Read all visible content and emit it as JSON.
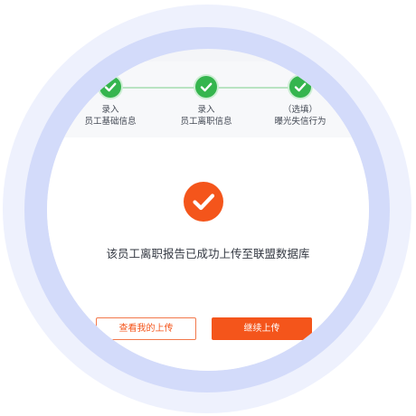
{
  "colors": {
    "accent": "#f4551b",
    "step_done": "#35b54e",
    "ring_outer": "#eef1fd",
    "ring_mid": "#d3dbfa"
  },
  "steps": [
    {
      "line1": "录入",
      "line2": "员工基础信息",
      "status": "done",
      "icon": "check-icon"
    },
    {
      "line1": "录入",
      "line2": "员工离职信息",
      "status": "done",
      "icon": "check-icon"
    },
    {
      "line1": "（选填）",
      "line2": "曝光失信行为",
      "status": "done",
      "icon": "check-icon"
    }
  ],
  "result": {
    "icon": "success-check-icon",
    "message": "该员工离职报告已成功上传至联盟数据库"
  },
  "actions": {
    "view_label": "查看我的上传",
    "continue_label": "继续上传"
  }
}
